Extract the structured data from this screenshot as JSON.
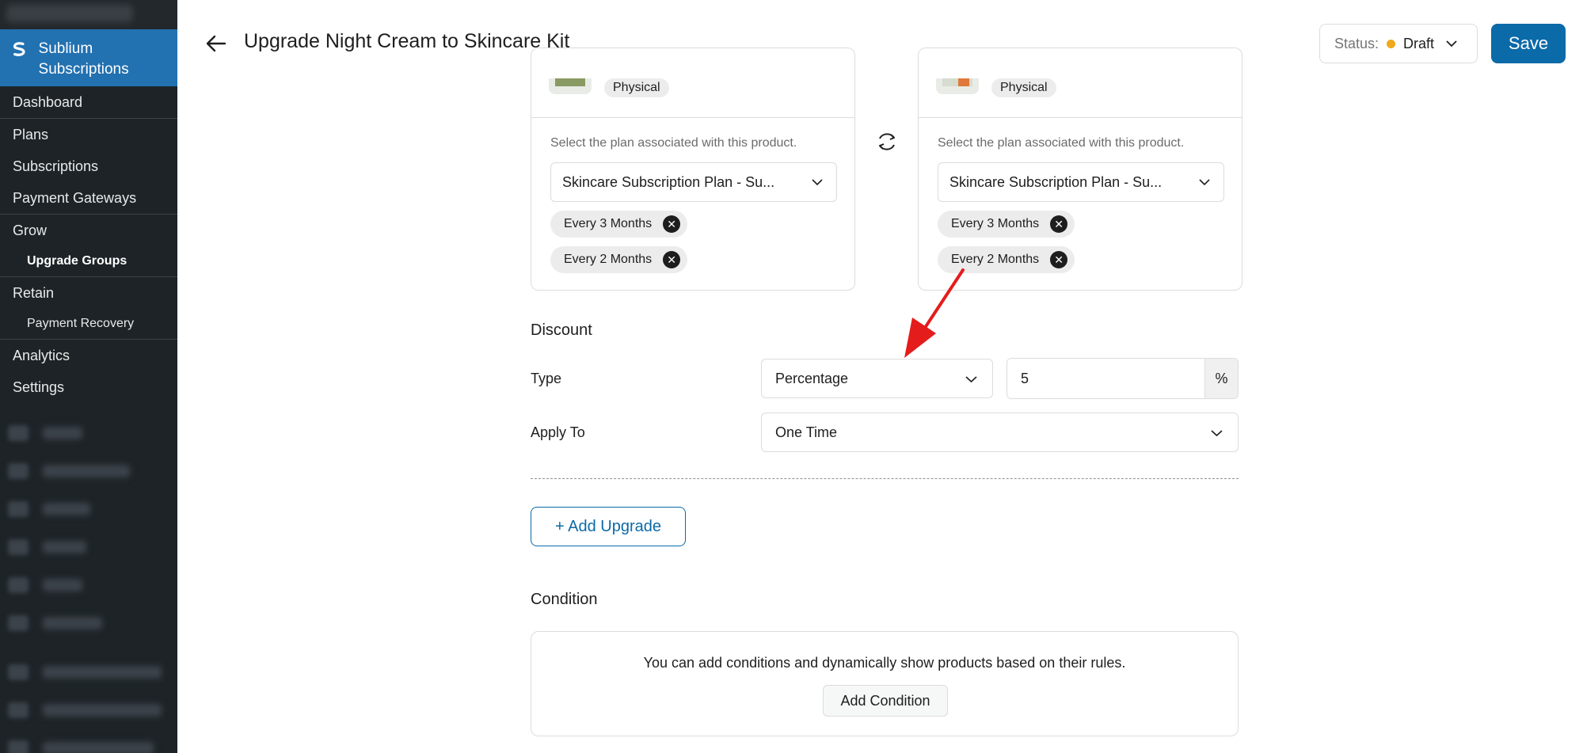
{
  "sidebar": {
    "brand": "Sublium Subscriptions",
    "items": [
      {
        "label": "Dashboard"
      },
      {
        "label": "Plans"
      },
      {
        "label": "Subscriptions"
      },
      {
        "label": "Payment Gateways"
      },
      {
        "label": "Grow"
      },
      {
        "label": "Upgrade Groups"
      },
      {
        "label": "Retain"
      },
      {
        "label": "Payment Recovery"
      },
      {
        "label": "Analytics"
      },
      {
        "label": "Settings"
      }
    ]
  },
  "header": {
    "title": "Upgrade Night Cream to Skincare Kit",
    "status_label": "Status:",
    "status_value": "Draft",
    "status_color": "#f0a81d",
    "save_label": "Save"
  },
  "products": [
    {
      "tag": "Physical",
      "help": "Select the plan associated with this product.",
      "plan": "Skincare Subscription Plan - Su...",
      "chips": [
        "Every 3 Months",
        "Every 2 Months"
      ]
    },
    {
      "tag": "Physical",
      "help": "Select the plan associated with this product.",
      "plan": "Skincare Subscription Plan - Su...",
      "chips": [
        "Every 3 Months",
        "Every 2 Months"
      ]
    }
  ],
  "discount": {
    "title": "Discount",
    "type_label": "Type",
    "type_value": "Percentage",
    "amount": "5",
    "amount_suffix": "%",
    "apply_label": "Apply To",
    "apply_value": "One Time"
  },
  "add_upgrade_label": "+ Add Upgrade",
  "condition": {
    "title": "Condition",
    "text": "You can add conditions and dynamically show products based on their rules.",
    "button": "Add Condition"
  },
  "colors": {
    "sidebar_bg": "#1d2327",
    "brand_bg": "#2271b1",
    "primary": "#0b6aa8",
    "annotation_arrow": "#e51c1c"
  }
}
